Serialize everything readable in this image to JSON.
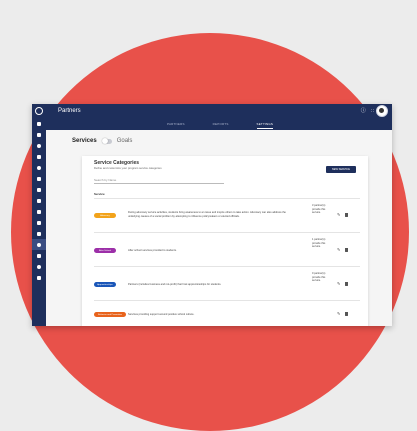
{
  "app": {
    "title": "Partners"
  },
  "top_tabs": [
    {
      "label": "PARTNERS",
      "active": false
    },
    {
      "label": "REPORTS",
      "active": false
    },
    {
      "label": "SETTINGS",
      "active": true
    }
  ],
  "top_icons": [
    "help-icon",
    "grid-icon",
    "avatar"
  ],
  "sidebar": {
    "icons": [
      "home-icon",
      "list-icon",
      "user-icon",
      "people-icon",
      "location-icon",
      "clipboard-icon",
      "mail-icon",
      "filter-icon",
      "checklist-icon",
      "export-icon",
      "star-icon",
      "settings-circle-icon",
      "calendar-icon",
      "gear-icon",
      "phone-icon"
    ],
    "active_index": 11
  },
  "page_tabs": {
    "services": "Services",
    "goals": "Goals"
  },
  "card": {
    "title": "Service Categories",
    "subtitle": "Define and customize your program service categories",
    "new_button": "NEW SERVICE",
    "search_placeholder": "Search by Name",
    "column_header": "Service"
  },
  "rows": [
    {
      "name": "Advocacy",
      "color": "#f2a31b",
      "description": "During advocacy service activities, students bring awareness to an issue and inspire others to take action. Advocacy can also address the underlying causes of a social problem by attempting to influence policymakers or elected officials.",
      "count": "3 partner(s) provide this service."
    },
    {
      "name": "After School",
      "color": "#9c2fa8",
      "description": "After school services provided to students.",
      "count": "1 partner(s) provide this service."
    },
    {
      "name": "Apprenticeships",
      "color": "#1a56b8",
      "description": "Partners (includes business and not-profit) that host apprenticeships for students.",
      "count": "0 partner(s) provide this service."
    },
    {
      "name": "Behavior and Prevention",
      "color": "#e8631c",
      "description": "Services providing support around positive school culture.",
      "count": ""
    }
  ],
  "colors": {
    "nav": "#1e2f5c",
    "background_circle": "#e8514a"
  }
}
